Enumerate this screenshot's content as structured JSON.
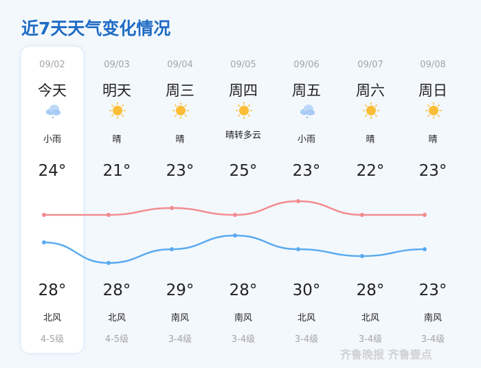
{
  "title": "近7天天气变化情况",
  "days": [
    {
      "date": "09/02",
      "day": "今天",
      "icon": "rain-cloud-icon",
      "cond": "小雨",
      "low": "24°",
      "high": "28°",
      "wind": "北风",
      "level": "4-5级"
    },
    {
      "date": "09/03",
      "day": "明天",
      "icon": "sun-icon",
      "cond": "晴",
      "low": "21°",
      "high": "28°",
      "wind": "北风",
      "level": "4-5级"
    },
    {
      "date": "09/04",
      "day": "周三",
      "icon": "sun-icon",
      "cond": "晴",
      "low": "23°",
      "high": "29°",
      "wind": "南风",
      "level": "3-4级"
    },
    {
      "date": "09/05",
      "day": "周四",
      "icon": "sun-icon",
      "cond": "晴转多云",
      "low": "25°",
      "high": "28°",
      "wind": "南风",
      "level": "3-4级"
    },
    {
      "date": "09/06",
      "day": "周五",
      "icon": "rain-cloud-icon",
      "cond": "小雨",
      "low": "23°",
      "high": "30°",
      "wind": "北风",
      "level": "3-4级"
    },
    {
      "date": "09/07",
      "day": "周六",
      "icon": "sun-icon",
      "cond": "晴",
      "low": "22°",
      "high": "28°",
      "wind": "北风",
      "level": "3-4级"
    },
    {
      "date": "09/08",
      "day": "周日",
      "icon": "sun-icon",
      "cond": "晴",
      "low": "23°",
      "high": "23°",
      "wind": "南风",
      "level": "3-4级"
    }
  ],
  "chart_data": {
    "type": "line",
    "categories": [
      "09/02",
      "09/03",
      "09/04",
      "09/05",
      "09/06",
      "09/07",
      "09/08"
    ],
    "series": [
      {
        "values": [
          28,
          28,
          29,
          28,
          30,
          28,
          28
        ],
        "color": "#f28b8f"
      },
      {
        "values": [
          24,
          21,
          23,
          25,
          23,
          22,
          23
        ],
        "color": "#5aaaf0"
      }
    ]
  },
  "watermark": "齐鲁晚报 齐鲁壹点"
}
